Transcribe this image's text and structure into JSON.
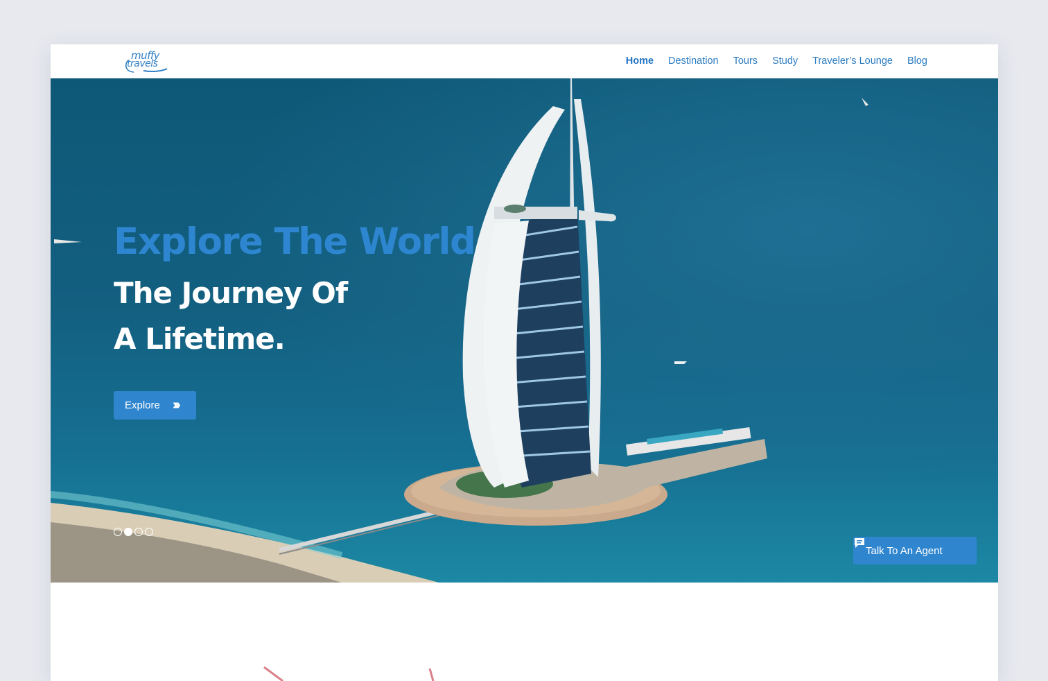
{
  "brand": {
    "logo_line1": "muffy",
    "logo_line2": "travels"
  },
  "nav": {
    "items": [
      {
        "label": "Home",
        "active": true
      },
      {
        "label": "Destination"
      },
      {
        "label": "Tours"
      },
      {
        "label": "Study"
      },
      {
        "label": "Traveler’s Lounge"
      },
      {
        "label": "Blog"
      }
    ]
  },
  "hero": {
    "title_accent": "Explore The World",
    "title_line1": "The Journey Of",
    "title_line2": "A Lifetime.",
    "cta_label": "Explore",
    "slides_total": 4,
    "slide_active": 2,
    "image": "aerial-sail-shaped-hotel-on-island-over-blue-sea"
  },
  "agent": {
    "label": "Talk To An Agent",
    "icon": "chat-icon"
  },
  "colors": {
    "accent": "#2f86cf",
    "nav_text": "#2b7bc1",
    "page_bg": "#e7e9ef"
  }
}
